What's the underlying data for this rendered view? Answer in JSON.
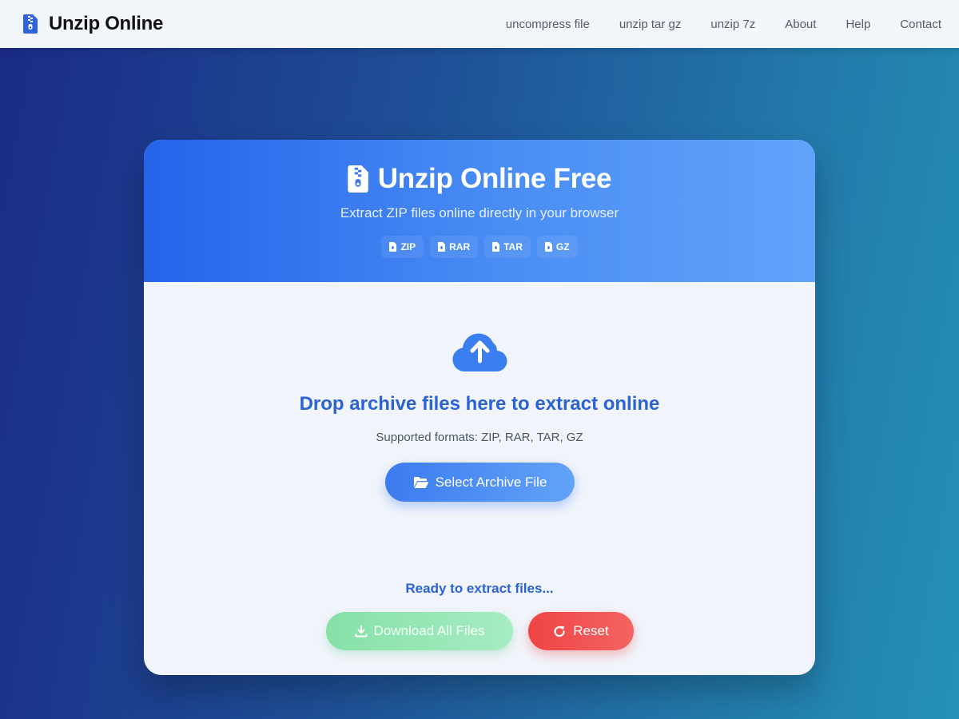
{
  "navbar": {
    "brand": "Unzip Online",
    "brand_icon": "zip-file-icon",
    "links": [
      {
        "label": "uncompress file"
      },
      {
        "label": "unzip tar gz"
      },
      {
        "label": "unzip 7z"
      },
      {
        "label": "About"
      },
      {
        "label": "Help"
      },
      {
        "label": "Contact"
      }
    ]
  },
  "header": {
    "title": "Unzip Online Free",
    "title_icon": "zip-file-icon",
    "subtitle": "Extract ZIP files online directly in your browser",
    "badges": [
      "ZIP",
      "RAR",
      "TAR",
      "GZ"
    ]
  },
  "drop_zone": {
    "icon": "cloud-upload-icon",
    "title": "Drop archive files here to extract online",
    "formats": "Supported formats: ZIP, RAR, TAR, GZ",
    "select_button": "Select Archive File",
    "select_icon": "folder-open-icon"
  },
  "status": "Ready to extract files...",
  "actions": {
    "download": "Download All Files",
    "download_icon": "download-icon",
    "reset": "Reset",
    "reset_icon": "redo-icon"
  },
  "colors": {
    "accent": "#2b62d4",
    "header_gradient_start": "#2563eb",
    "header_gradient_end": "#61a3fa",
    "download": "#86e0a8",
    "reset": "#ef4444"
  }
}
